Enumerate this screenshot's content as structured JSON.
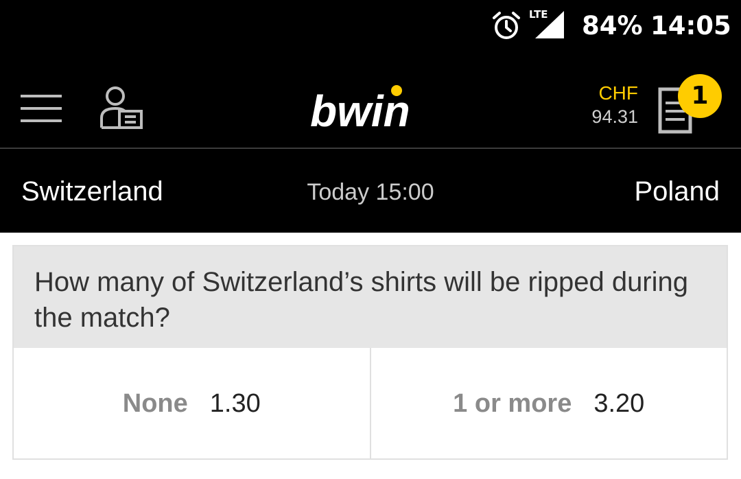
{
  "status_bar": {
    "icons": [
      "alarm-clock-icon",
      "lte-signal-icon"
    ],
    "network": "LTE",
    "battery": "84%",
    "time": "14:05"
  },
  "header": {
    "logo_text": "bwin",
    "logo_dot_color": "#ffcc00",
    "icons": [
      "hamburger-menu-icon",
      "account-icon",
      "betslip-icon"
    ],
    "currency": "CHF",
    "balance": "94.31",
    "betslip_count": "1"
  },
  "match": {
    "home_team": "Switzerland",
    "kickoff": "Today 15:00",
    "away_team": "Poland"
  },
  "market": {
    "question": "How many of Switzerland’s shirts will be ripped during the match?",
    "options": [
      {
        "label": "None",
        "odds": "1.30"
      },
      {
        "label": "1 or more",
        "odds": "3.20"
      }
    ]
  },
  "colors": {
    "accent": "#ffcc00",
    "header_bg": "#000000",
    "question_bg": "#e6e6e6"
  }
}
